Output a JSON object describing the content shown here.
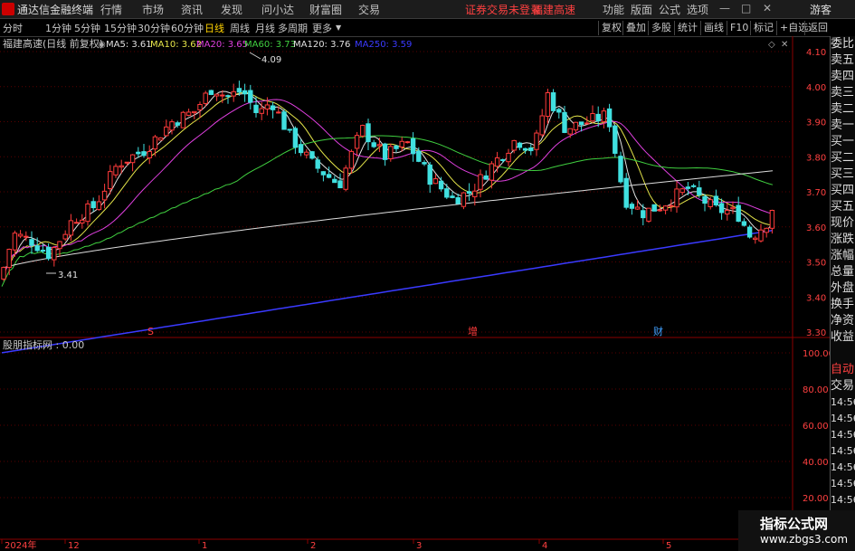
{
  "menubar": {
    "app_title": "通达信金融终端",
    "menu": [
      "行情",
      "市场",
      "资讯",
      "发现",
      "问小达",
      "财富圈",
      "交易"
    ],
    "status": "证券交易未登录",
    "stock": "福建高速",
    "right_menu": [
      "功能",
      "版面",
      "公式",
      "选项"
    ],
    "guest": "游客"
  },
  "tabbar": {
    "periods": [
      "分时",
      "1分钟",
      "5分钟",
      "15分钟",
      "30分钟",
      "60分钟",
      "日线",
      "周线",
      "月线",
      "多周期",
      "更多"
    ],
    "active": "日线",
    "buttons": [
      "复权",
      "叠加",
      "多股",
      "统计",
      "画线",
      "F10",
      "标记",
      "+自选",
      "返回"
    ]
  },
  "main_panel": {
    "title": "福建高速(日线 前复权)",
    "ma_labels": [
      {
        "text": "MA5: 3.61",
        "color": "#e0e0e0"
      },
      {
        "text": "MA10: 3.62",
        "color": "#e6e64a"
      },
      {
        "text": "MA20: 3.65",
        "color": "#e040e0"
      },
      {
        "text": "MA60: 3.73",
        "color": "#40d040"
      },
      {
        "text": "MA120: 3.76",
        "color": "#e0e0e0"
      },
      {
        "text": "MA250: 3.59",
        "color": "#3a3aff"
      }
    ],
    "high_marker": "4.09",
    "low_marker": "3.41",
    "price_axis": [
      "4.10",
      "4.00",
      "3.90",
      "3.80",
      "3.70",
      "3.60",
      "3.50",
      "3.40",
      "3.30"
    ],
    "event_marks": [
      "S",
      "增",
      "财"
    ]
  },
  "sub_panel": {
    "title": "股朋指标网 : 0.00",
    "axis": [
      "100.00",
      "80.00",
      "60.00",
      "40.00",
      "20.00"
    ]
  },
  "date_axis": {
    "labels": [
      "2024年",
      "12",
      "1",
      "2",
      "3",
      "4",
      "5"
    ]
  },
  "sidebar": [
    "委比",
    "卖五",
    "卖四",
    "卖三",
    "卖二",
    "卖一",
    "买一",
    "买二",
    "买三",
    "买四",
    "买五",
    "现价",
    "涨跌",
    "涨幅",
    "总量",
    "外盘",
    "换手",
    "净资",
    "收益",
    "",
    "自动",
    "交易",
    "14:56",
    "14:56",
    "14:56",
    "14:56",
    "14:56",
    "14:56",
    "14:56",
    "14:56"
  ],
  "watermark": {
    "line1": "指标公式网",
    "line2": "www.zbgs3.com"
  },
  "colors": {
    "up": "#ff3b3b",
    "down": "#40e0e0",
    "grid": "#8b0000",
    "ma250": "#3a3aff"
  }
}
